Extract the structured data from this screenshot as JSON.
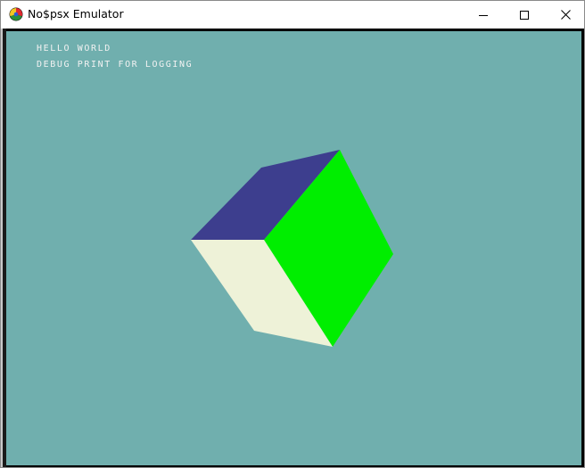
{
  "window": {
    "title": "No$psx Emulator",
    "app_icon": "nocash-psx-icon",
    "controls": {
      "minimize_icon": "minimize-icon",
      "maximize_icon": "maximize-icon",
      "close_icon": "close-icon"
    }
  },
  "screen": {
    "background_color": "#70afae",
    "debug_text": [
      "HELLO WORLD",
      "DEBUG PRINT FOR LOGGING"
    ],
    "text_color": "#f2f2f2"
  },
  "cube": {
    "faces": [
      {
        "name": "top-face",
        "color": "#3d3e8e"
      },
      {
        "name": "right-face",
        "color": "#00ee00"
      },
      {
        "name": "left-face",
        "color": "#eef2d8"
      }
    ]
  }
}
